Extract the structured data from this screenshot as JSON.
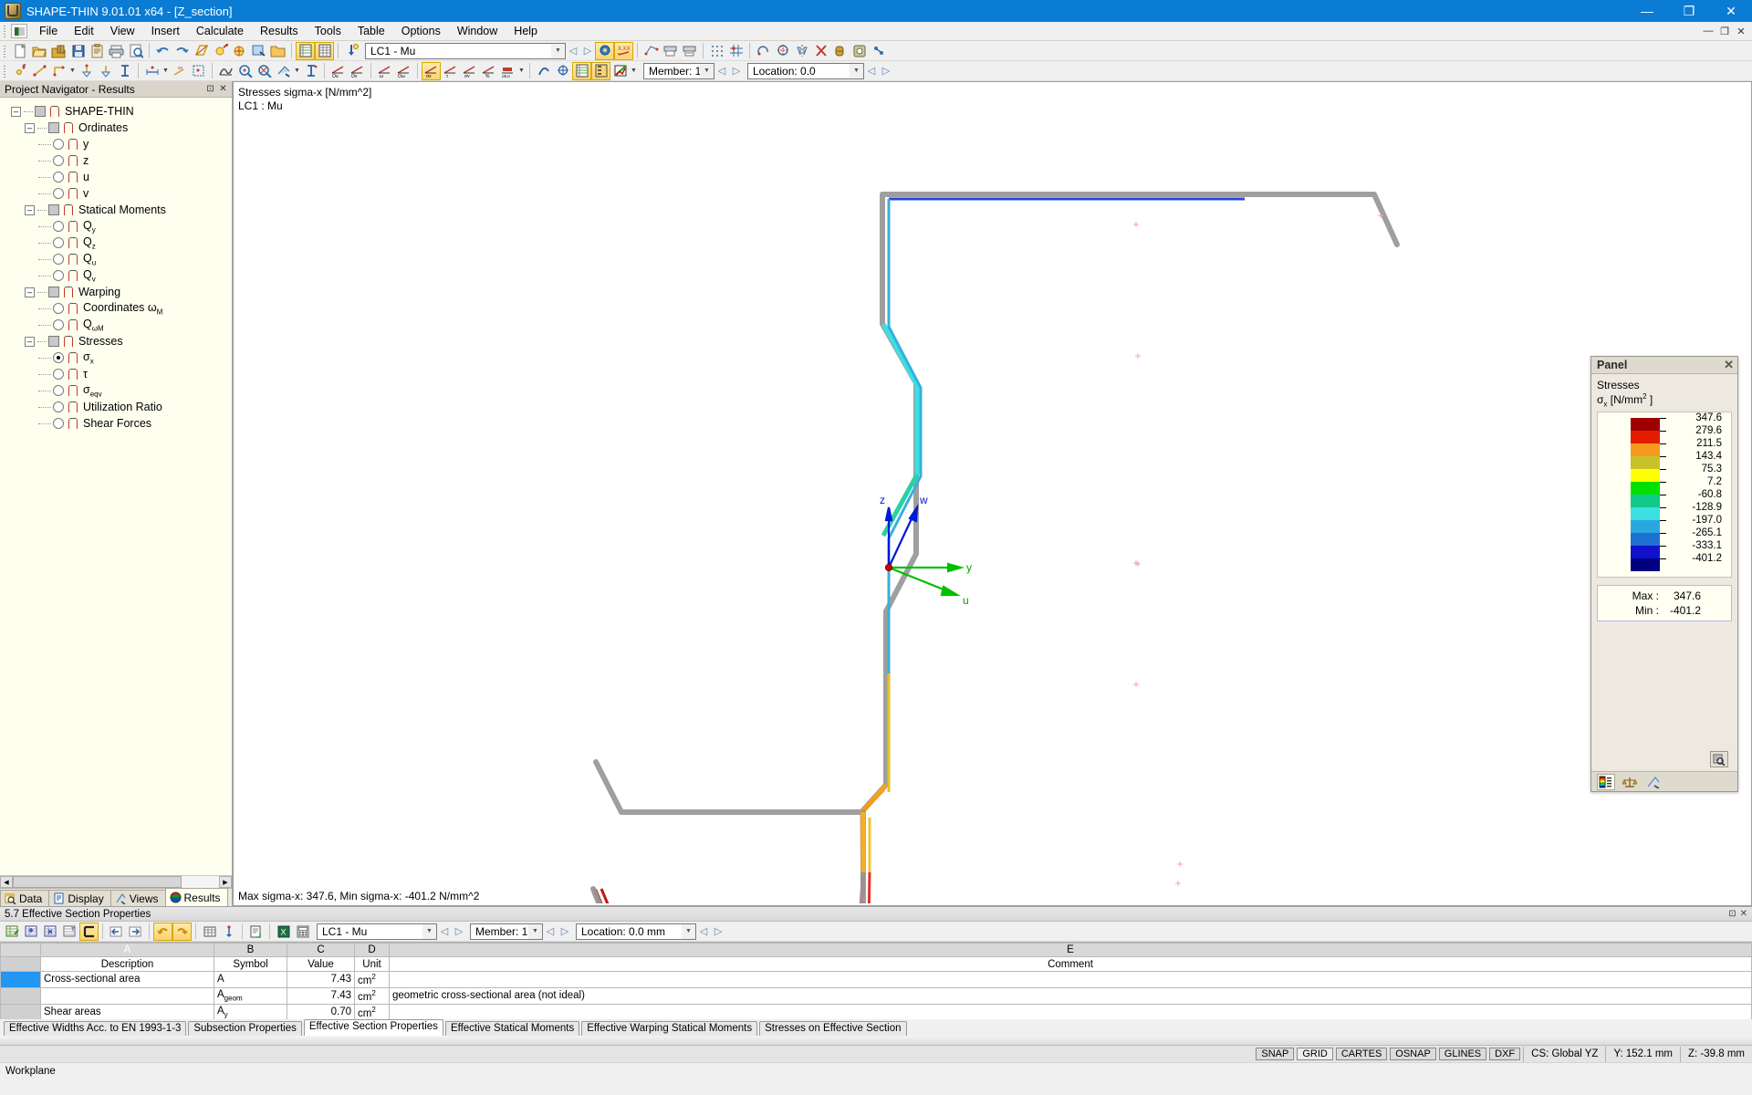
{
  "window": {
    "title": "SHAPE-THIN 9.01.01 x64 - [Z_section]",
    "minimize": "—",
    "maximize": "❐",
    "close": "✕",
    "inner_minimize": "—",
    "inner_maximize": "❐",
    "inner_close": "✕"
  },
  "menu": {
    "items": [
      "File",
      "Edit",
      "View",
      "Insert",
      "Calculate",
      "Results",
      "Tools",
      "Table",
      "Options",
      "Window",
      "Help"
    ]
  },
  "toolbar1": {
    "load_case": "LC1 - Mu",
    "icons": [
      "new-document-icon",
      "open-folder-icon",
      "open-package-icon",
      "save-icon",
      "clipboard-icon",
      "print-icon",
      "print-preview-icon",
      "undo-icon",
      "redo-icon",
      "section-icon",
      "zoom-point-icon",
      "zoom-circle-icon",
      "select-window-icon",
      "folder-open-icon",
      "table-list-icon",
      "table-grid-icon",
      "load-icon"
    ]
  },
  "toolbar2": {
    "member": "Member: 1",
    "location": "Location:  0.0"
  },
  "navigator": {
    "header": "Project Navigator - Results",
    "tree": [
      {
        "level": 0,
        "label": "SHAPE-THIN",
        "type": "group",
        "expanded": true
      },
      {
        "level": 1,
        "label": "Ordinates",
        "type": "group",
        "expanded": true
      },
      {
        "level": 2,
        "label": "y",
        "type": "radio",
        "selected": false
      },
      {
        "level": 2,
        "label": "z",
        "type": "radio",
        "selected": false
      },
      {
        "level": 2,
        "label": "u",
        "type": "radio",
        "selected": false
      },
      {
        "level": 2,
        "label": "v",
        "type": "radio",
        "selected": false
      },
      {
        "level": 1,
        "label": "Statical Moments",
        "type": "group",
        "expanded": true
      },
      {
        "level": 2,
        "label": "Qy",
        "sub": "y",
        "base": "Q",
        "type": "radio",
        "selected": false
      },
      {
        "level": 2,
        "label": "Qz",
        "sub": "z",
        "base": "Q",
        "type": "radio",
        "selected": false
      },
      {
        "level": 2,
        "label": "Qu",
        "sub": "u",
        "base": "Q",
        "type": "radio",
        "selected": false
      },
      {
        "level": 2,
        "label": "Qv",
        "sub": "v",
        "base": "Q",
        "type": "radio",
        "selected": false
      },
      {
        "level": 1,
        "label": "Warping",
        "type": "group",
        "expanded": true
      },
      {
        "level": 2,
        "label": "Coordinates ωM",
        "sub": "M",
        "base": "Coordinates ω",
        "type": "radio",
        "selected": false
      },
      {
        "level": 2,
        "label": "QωM",
        "sub": "ωM",
        "base": "Q",
        "type": "radio",
        "selected": false
      },
      {
        "level": 1,
        "label": "Stresses",
        "type": "group",
        "expanded": true
      },
      {
        "level": 2,
        "label": "σx",
        "sub": "x",
        "base": "σ",
        "type": "radio",
        "selected": true
      },
      {
        "level": 2,
        "label": "τ",
        "base": "τ",
        "sub": "",
        "type": "radio",
        "selected": false
      },
      {
        "level": 2,
        "label": "σeqv",
        "sub": "eqv",
        "base": "σ",
        "type": "radio",
        "selected": false
      },
      {
        "level": 2,
        "label": "Utilization Ratio",
        "base": "Utilization Ratio",
        "sub": "",
        "type": "radio",
        "selected": false
      },
      {
        "level": 2,
        "label": "Shear Forces",
        "base": "Shear Forces",
        "sub": "",
        "type": "radio",
        "selected": false
      }
    ],
    "tabs": [
      {
        "label": "Data",
        "icon": "data-icon",
        "selected": false
      },
      {
        "label": "Display",
        "icon": "display-icon",
        "selected": false
      },
      {
        "label": "Views",
        "icon": "views-icon",
        "selected": false
      },
      {
        "label": "Results",
        "icon": "results-icon",
        "selected": true
      }
    ]
  },
  "viewport": {
    "label_line1": "Stresses sigma-x [N/mm^2]",
    "label_line2": "LC1 : Mu",
    "footer": "Max sigma-x: 347.6, Min sigma-x: -401.2 N/mm^2",
    "axis_labels": {
      "z": "z",
      "w": "w",
      "y": "y",
      "u": "u"
    }
  },
  "panel": {
    "title": "Panel",
    "close": "✕",
    "heading": "Stresses",
    "quantity": "σx [N/mm2 ]",
    "quantity_base": "σ",
    "quantity_sub": "x",
    "quantity_unit": " [N/mm",
    "quantity_sup": "2",
    "quantity_tail": " ]",
    "max_label": "Max :",
    "max_value": "347.6",
    "min_label": "Min  :",
    "min_value": "-401.2",
    "zoom_icon": "magnifier-icon",
    "tabs": [
      "color-legend-icon",
      "scales-icon",
      "view-factor-icon"
    ]
  },
  "chart_data": {
    "type": "heatmap",
    "title": "Stresses sigma-x [N/mm^2]",
    "subtitle": "LC1 : Mu",
    "ylabel": "σx [N/mm2]",
    "legend_position": "right",
    "legend_stops": [
      {
        "value": 347.6,
        "color": "#9e0000"
      },
      {
        "value": 279.6,
        "color": "#e51b00"
      },
      {
        "value": 211.5,
        "color": "#f59a1e"
      },
      {
        "value": 143.4,
        "color": "#c9c12a"
      },
      {
        "value": 75.3,
        "color": "#ffff00"
      },
      {
        "value": 7.2,
        "color": "#00e000"
      },
      {
        "value": -60.8,
        "color": "#12c98c"
      },
      {
        "value": -128.9,
        "color": "#3ce0e0"
      },
      {
        "value": -197.0,
        "color": "#29a8e0"
      },
      {
        "value": -265.1,
        "color": "#1f6fd0"
      },
      {
        "value": -333.1,
        "color": "#1111cc"
      },
      {
        "value": -401.2,
        "color": "#000080"
      }
    ],
    "max": 347.6,
    "min": -401.2,
    "units": "N/mm^2"
  },
  "table_window": {
    "title": "5.7 Effective Section Properties",
    "load_case": "LC1 - Mu",
    "member": "Member: 1",
    "location": "Location:  0.0 mm",
    "columns": [
      "",
      "A",
      "B",
      "C",
      "D",
      "E"
    ],
    "header_row": [
      "",
      "Description",
      "Symbol",
      "Value",
      "Unit",
      "Comment"
    ],
    "rows": [
      {
        "selected": true,
        "description": "Cross-sectional area",
        "symbol_base": "A",
        "symbol_sub": "",
        "value": "7.43",
        "unit": "cm",
        "unit_sup": "2",
        "comment": ""
      },
      {
        "selected": false,
        "description": "",
        "symbol_base": "A",
        "symbol_sub": "geom",
        "value": "7.43",
        "unit": "cm",
        "unit_sup": "2",
        "comment": "geometric cross-sectional area (not ideal)"
      },
      {
        "selected": false,
        "description": "Shear areas",
        "symbol_base": "A",
        "symbol_sub": "y",
        "value": "0.70",
        "unit": "cm",
        "unit_sup": "2",
        "comment": ""
      }
    ],
    "tabs": [
      {
        "label": "Effective Widths Acc. to EN 1993-1-3",
        "selected": false
      },
      {
        "label": "Subsection Properties",
        "selected": false
      },
      {
        "label": "Effective Section Properties",
        "selected": true
      },
      {
        "label": "Effective Statical Moments",
        "selected": false
      },
      {
        "label": "Effective Warping Statical Moments",
        "selected": false
      },
      {
        "label": "Stresses on Effective Section",
        "selected": false
      }
    ]
  },
  "statusbar": {
    "workplane": "Workplane",
    "buttons": [
      {
        "label": "SNAP",
        "on": false
      },
      {
        "label": "GRID",
        "on": true
      },
      {
        "label": "CARTES",
        "on": false
      },
      {
        "label": "OSNAP",
        "on": false
      },
      {
        "label": "GLINES",
        "on": false
      },
      {
        "label": "DXF",
        "on": false
      }
    ],
    "cs": "CS: Global YZ",
    "y": "Y:  152.1 mm",
    "z": "Z:  -39.8 mm"
  }
}
